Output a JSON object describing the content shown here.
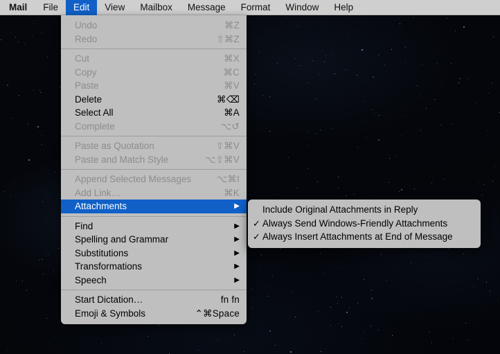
{
  "menubar": {
    "items": [
      {
        "label": "Mail",
        "bold": true,
        "active": false
      },
      {
        "label": "File",
        "bold": false,
        "active": false
      },
      {
        "label": "Edit",
        "bold": false,
        "active": true
      },
      {
        "label": "View",
        "bold": false,
        "active": false
      },
      {
        "label": "Mailbox",
        "bold": false,
        "active": false
      },
      {
        "label": "Message",
        "bold": false,
        "active": false
      },
      {
        "label": "Format",
        "bold": false,
        "active": false
      },
      {
        "label": "Window",
        "bold": false,
        "active": false
      },
      {
        "label": "Help",
        "bold": false,
        "active": false
      }
    ]
  },
  "edit_menu": {
    "groups": [
      {
        "items": [
          {
            "label": "Undo",
            "shortcut": "⌘Z",
            "enabled": false,
            "submenu": false,
            "selected": false
          },
          {
            "label": "Redo",
            "shortcut": "⇧⌘Z",
            "enabled": false,
            "submenu": false,
            "selected": false
          }
        ]
      },
      {
        "items": [
          {
            "label": "Cut",
            "shortcut": "⌘X",
            "enabled": false,
            "submenu": false,
            "selected": false
          },
          {
            "label": "Copy",
            "shortcut": "⌘C",
            "enabled": false,
            "submenu": false,
            "selected": false
          },
          {
            "label": "Paste",
            "shortcut": "⌘V",
            "enabled": false,
            "submenu": false,
            "selected": false
          },
          {
            "label": "Delete",
            "shortcut": "⌘⌫",
            "enabled": true,
            "submenu": false,
            "selected": false
          },
          {
            "label": "Select All",
            "shortcut": "⌘A",
            "enabled": true,
            "submenu": false,
            "selected": false
          },
          {
            "label": "Complete",
            "shortcut": "⌥↺",
            "enabled": false,
            "submenu": false,
            "selected": false
          }
        ]
      },
      {
        "items": [
          {
            "label": "Paste as Quotation",
            "shortcut": "⇧⌘V",
            "enabled": false,
            "submenu": false,
            "selected": false
          },
          {
            "label": "Paste and Match Style",
            "shortcut": "⌥⇧⌘V",
            "enabled": false,
            "submenu": false,
            "selected": false
          }
        ]
      },
      {
        "items": [
          {
            "label": "Append Selected Messages",
            "shortcut": "⌥⌘I",
            "enabled": false,
            "submenu": false,
            "selected": false
          },
          {
            "label": "Add Link…",
            "shortcut": "⌘K",
            "enabled": false,
            "submenu": false,
            "selected": false
          },
          {
            "label": "Attachments",
            "shortcut": "",
            "enabled": true,
            "submenu": true,
            "selected": true
          }
        ]
      },
      {
        "items": [
          {
            "label": "Find",
            "shortcut": "",
            "enabled": true,
            "submenu": true,
            "selected": false
          },
          {
            "label": "Spelling and Grammar",
            "shortcut": "",
            "enabled": true,
            "submenu": true,
            "selected": false
          },
          {
            "label": "Substitutions",
            "shortcut": "",
            "enabled": true,
            "submenu": true,
            "selected": false
          },
          {
            "label": "Transformations",
            "shortcut": "",
            "enabled": true,
            "submenu": true,
            "selected": false
          },
          {
            "label": "Speech",
            "shortcut": "",
            "enabled": true,
            "submenu": true,
            "selected": false
          }
        ]
      },
      {
        "items": [
          {
            "label": "Start Dictation…",
            "shortcut": "fn fn",
            "enabled": true,
            "submenu": false,
            "selected": false
          },
          {
            "label": "Emoji & Symbols",
            "shortcut": "⌃⌘Space",
            "enabled": true,
            "submenu": false,
            "selected": false
          }
        ]
      }
    ]
  },
  "attachments_submenu": {
    "title": "Attachments",
    "items": [
      {
        "label": "Include Original Attachments in Reply",
        "checked": false
      },
      {
        "label": "Always Send Windows-Friendly Attachments",
        "checked": true
      },
      {
        "label": "Always Insert Attachments at End of Message",
        "checked": true
      }
    ],
    "check_glyph": "✓"
  },
  "colors": {
    "menu_background": "#bfbfbf",
    "menubar_background": "#cfcfcf",
    "highlight_blue": "#1060c8",
    "disabled_text": "#8c8c8c",
    "enabled_text": "#000000",
    "desktop": "#05070c"
  },
  "desktop": {
    "wallpaper_name": "dark-starfield-wallpaper"
  }
}
